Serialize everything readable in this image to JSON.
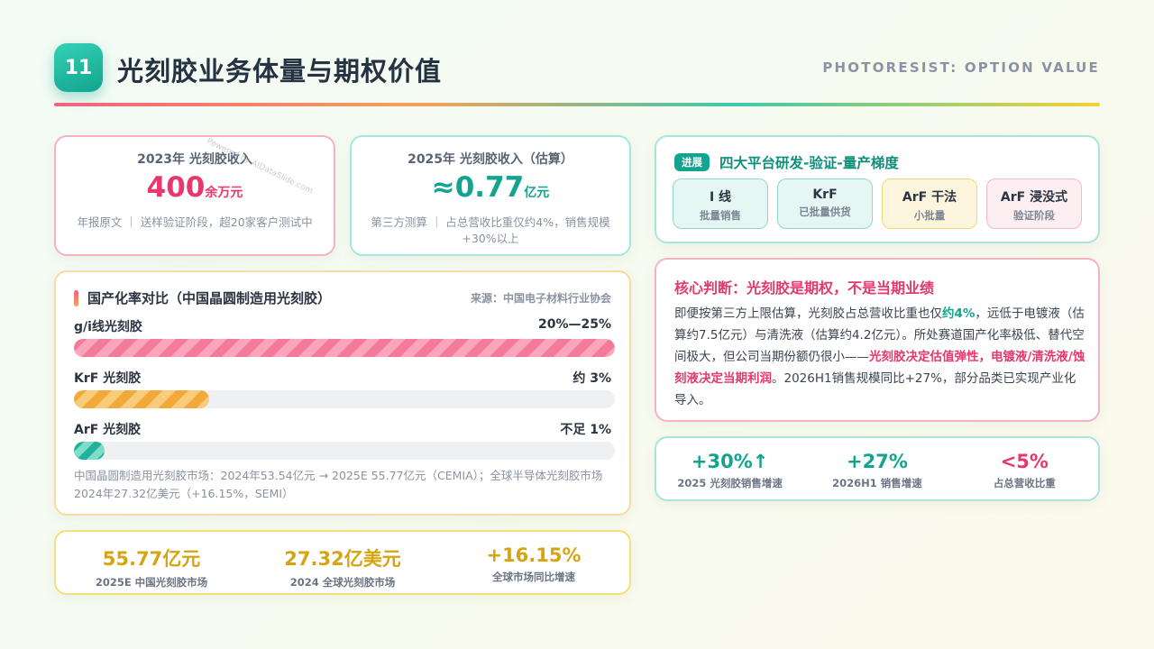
{
  "header": {
    "number": "11",
    "title": "光刻胶业务体量与期权价值",
    "subtitle_en": "PHOTORESIST: OPTION VALUE"
  },
  "stamp": {
    "text": "Powered by AIDataSlide.com"
  },
  "stat_cards": [
    {
      "label": "2023年 光刻胶收入",
      "value": "400",
      "unit": "余万元",
      "note": "年报原文 ｜ 送样验证阶段，超20家客户测试中",
      "color": "#e6396b"
    },
    {
      "label": "2025年 光刻胶收入（估算）",
      "value": "≈0.77",
      "unit": "亿元",
      "note": "第三方测算 ｜ 占总营收比重仅约4%，销售规模+30%以上",
      "color": "#12a48e"
    }
  ],
  "localization": {
    "title": "国产化率对比（中国晶圆制造用光刻胶）",
    "source": "来源：中国电子材料行业协会",
    "rows": [
      {
        "label": "g/i线光刻胶",
        "value_text": "20%—25%",
        "fill_fraction": 1.0
      },
      {
        "label": "KrF 光刻胶",
        "value_text": "约 3%",
        "fill_fraction": 0.25
      },
      {
        "label": "ArF 光刻胶",
        "value_text": "不足 1%",
        "fill_fraction": 0.057
      }
    ],
    "footnote": "中国晶圆制造用光刻胶市场：2024年53.54亿元 → 2025E 55.77亿元（CEMIA）；全球半导体光刻胶市场 2024年27.32亿美元（+16.15%，SEMI）"
  },
  "kpi_left": [
    {
      "value": "55.77亿元",
      "caption": "2025E 中国光刻胶市场"
    },
    {
      "value": "27.32亿美元",
      "caption": "2024 全球光刻胶市场"
    },
    {
      "value": "+16.15%",
      "caption": "全球市场同比增速"
    }
  ],
  "platform": {
    "tag": "进展",
    "title": "四大平台研发-验证-量产梯度",
    "chips": [
      {
        "name": "I 线",
        "status": "批量销售"
      },
      {
        "name": "KrF",
        "status": "已批量供货"
      },
      {
        "name": "ArF 干法",
        "status": "小批量"
      },
      {
        "name": "ArF 浸没式",
        "status": "验证阶段"
      }
    ]
  },
  "judgment": {
    "title": "核心判断：光刻胶是期权，不是当期业绩",
    "p1": "即便按第三方上限估算，光刻胶占总营收比重也仅",
    "hl1": "约4%",
    "p2": "，远低于电镀液（估算约7.5亿元）与清洗液（估算约4.2亿元）。所处赛道国产化率极低、替代空间极大，但公司当期份额仍很小——",
    "hl2": "光刻胶决定估值弹性，电镀液/清洗液/蚀刻液决定当期利润",
    "p3": "。2026H1销售规模同比+27%，部分品类已实现产业化导入。"
  },
  "kpi_right": [
    {
      "value": "+30%↑",
      "caption": "2025 光刻胶销售增速",
      "color": "#12a48e"
    },
    {
      "value": "+27%",
      "caption": "2026H1 销售增速",
      "color": "#12a48e"
    },
    {
      "value": "<5%",
      "caption": "占总营收比重",
      "color": "#e6396b"
    }
  ]
}
